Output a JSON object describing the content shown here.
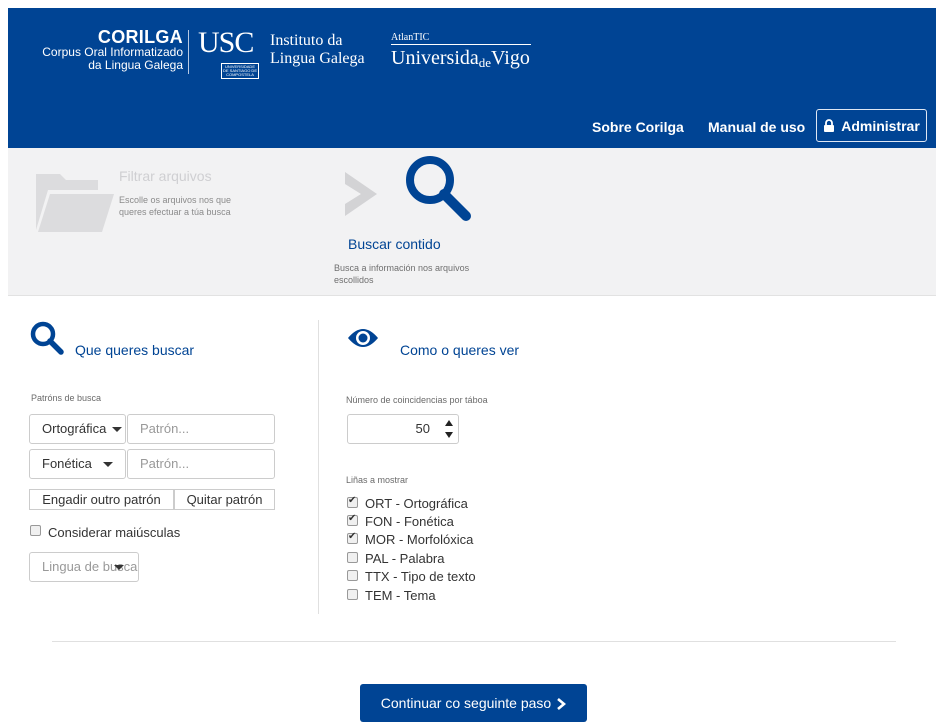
{
  "header": {
    "brand_title": "CORILGA",
    "brand_line1": "Corpus Oral Informatizado",
    "brand_line2": "da Lingua Galega",
    "usc_letters": "USC",
    "usc_tiny": "UNIVERSIDADE DE SANTIAGO DE COMPOSTELA",
    "ilg_line1": "Instituto da",
    "ilg_line2": "Lingua Galega",
    "atlantic": "AtlanTIC",
    "uvigo_main": "Universida",
    "uvigo_de": "de",
    "uvigo_end": "Vigo"
  },
  "nav": {
    "about": "Sobre Corilga",
    "manual": "Manual de uso",
    "admin": "Administrar"
  },
  "steps": {
    "step1_title": "Filtrar arquivos",
    "step1_desc": "Escolle os arquivos nos que queres efectuar a túa busca",
    "step2_title": "Buscar contido",
    "step2_desc": "Busca a información nos arquivos escollidos"
  },
  "search": {
    "title": "Que queres buscar",
    "patterns_label": "Patróns de busca",
    "rows": [
      {
        "type": "Ortográfica",
        "placeholder": "Patrón..."
      },
      {
        "type": "Fonética",
        "placeholder": "Patrón..."
      }
    ],
    "add_pattern": "Engadir outro patrón",
    "remove_pattern": "Quitar patrón",
    "case_label": "Considerar maiúsculas",
    "language_placeholder": "Lingua de busca"
  },
  "view": {
    "title": "Como o queres ver",
    "matches_label": "Número de coincidencias por táboa",
    "matches_value": "50",
    "lines_label": "Liñas a mostrar",
    "lines": [
      {
        "label": "ORT - Ortográfica",
        "checked": true
      },
      {
        "label": "FON - Fonética",
        "checked": true
      },
      {
        "label": "MOR - Morfolóxica",
        "checked": true
      },
      {
        "label": "PAL - Palabra",
        "checked": false
      },
      {
        "label": "TTX - Tipo de texto",
        "checked": false
      },
      {
        "label": "TEM - Tema",
        "checked": false
      }
    ]
  },
  "footer": {
    "continue": "Continuar co seguinte paso"
  },
  "colors": {
    "primary": "#004494",
    "steps_bg": "#f2f2f3"
  }
}
